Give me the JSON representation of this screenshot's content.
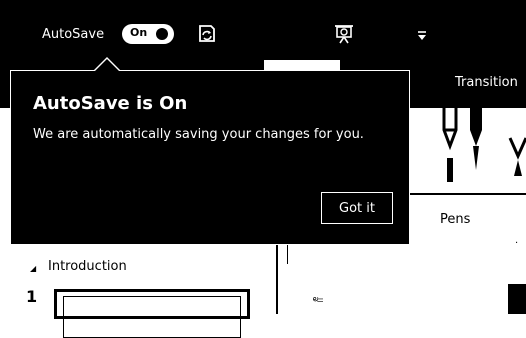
{
  "titlebar": {
    "autosave_label": "AutoSave",
    "autosave_toggle_state": "On",
    "icons": [
      "sync-icon",
      "present-icon",
      "quick-access-dropdown-icon"
    ]
  },
  "ribbon": {
    "tabs": [
      {
        "label": "Transition"
      }
    ],
    "pens_label": "Pens"
  },
  "slide_pane": {
    "section_title": "Introduction",
    "slide_number": "1"
  },
  "callout": {
    "title": "AutoSave is On",
    "body": "We are automatically saving your changes for you.",
    "button_label": "Got it"
  },
  "colors": {
    "background": "#000000",
    "foreground": "#ffffff"
  }
}
